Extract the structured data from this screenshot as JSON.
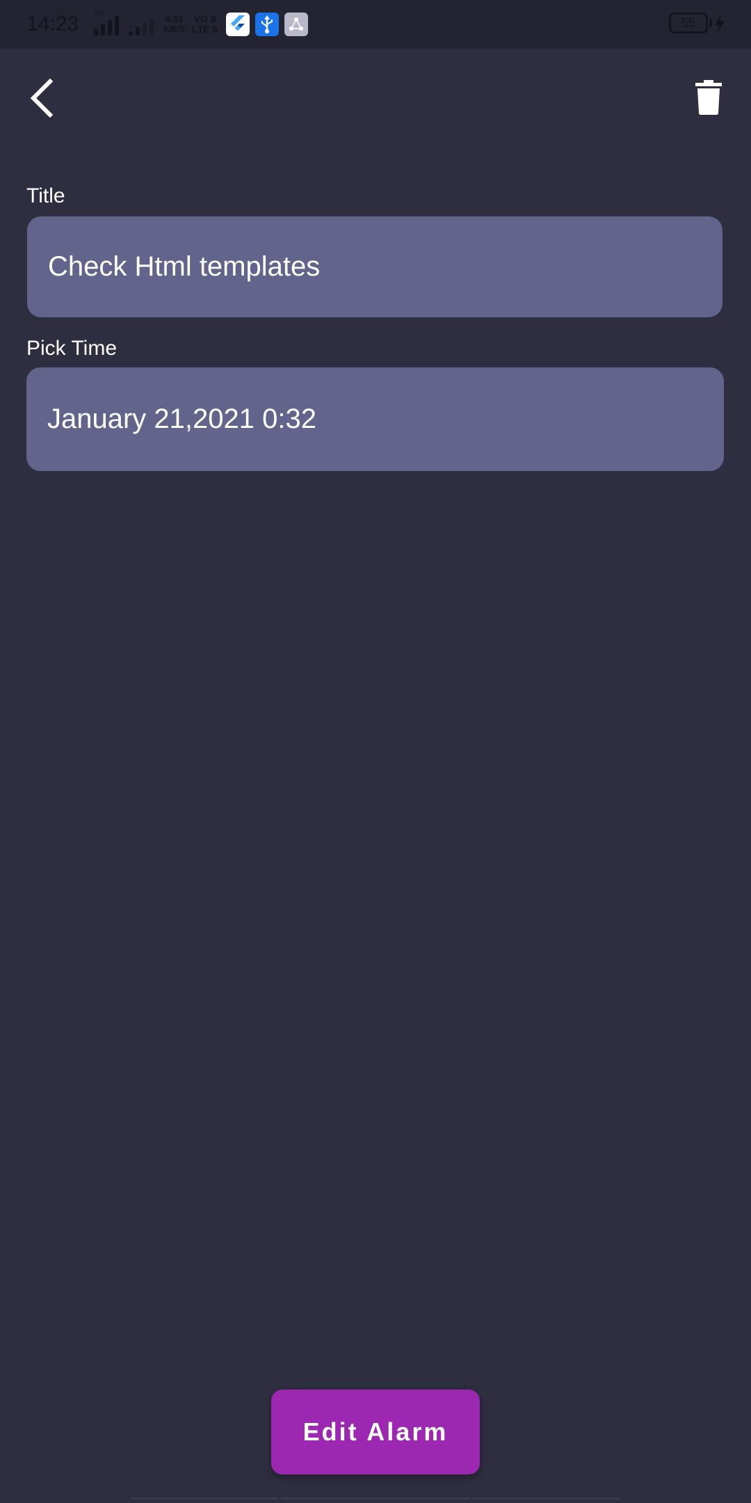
{
  "status_bar": {
    "time": "14:23",
    "network_type": "4G",
    "net_speed_value": "0.33",
    "net_speed_unit": "KB/S",
    "volte_line1": "VO 8",
    "volte_line2": "LTE 8",
    "battery_level": "55",
    "icons": [
      "signal-icon",
      "flutter-app-icon",
      "usb-icon",
      "share-app-icon",
      "battery-icon",
      "charging-icon"
    ]
  },
  "header": {
    "back_icon": "chevron-left-icon",
    "delete_icon": "trash-icon"
  },
  "form": {
    "title_label": "Title",
    "title_value": "Check Html templates",
    "time_label": "Pick Time",
    "time_value": "January 21,2021 0:32"
  },
  "actions": {
    "submit_label": "Edit Alarm"
  },
  "colors": {
    "background": "#2e2e40",
    "field_background": "#63648b",
    "accent": "#9c27b0"
  }
}
